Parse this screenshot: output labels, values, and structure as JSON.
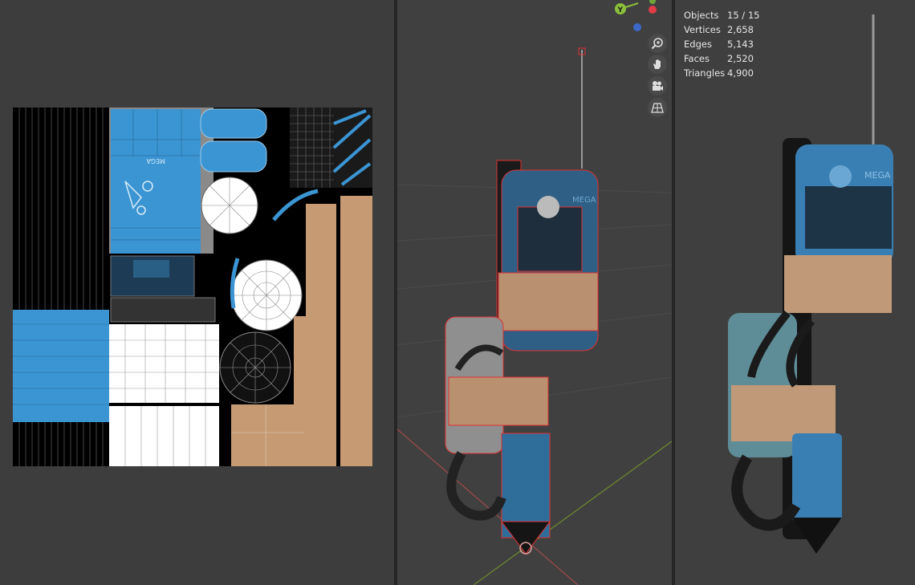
{
  "statistics": [
    {
      "label": "Objects",
      "value": "15 / 15"
    },
    {
      "label": "Vertices",
      "value": "2,658"
    },
    {
      "label": "Edges",
      "value": "5,143"
    },
    {
      "label": "Faces",
      "value": "2,520"
    },
    {
      "label": "Triangles",
      "value": "4,900"
    }
  ],
  "gizmo": {
    "y_axis_label": "Y"
  },
  "nav_icons": [
    "zoom-icon",
    "hand-pan-icon",
    "camera-icon",
    "perspective-grid-icon"
  ],
  "texture": {
    "brand_text": "MEGA"
  },
  "colors": {
    "background": "#3d3d3d",
    "accent_blue": "#3b95d3",
    "cardboard": "#c69a72",
    "selection_red": "#e03030"
  }
}
